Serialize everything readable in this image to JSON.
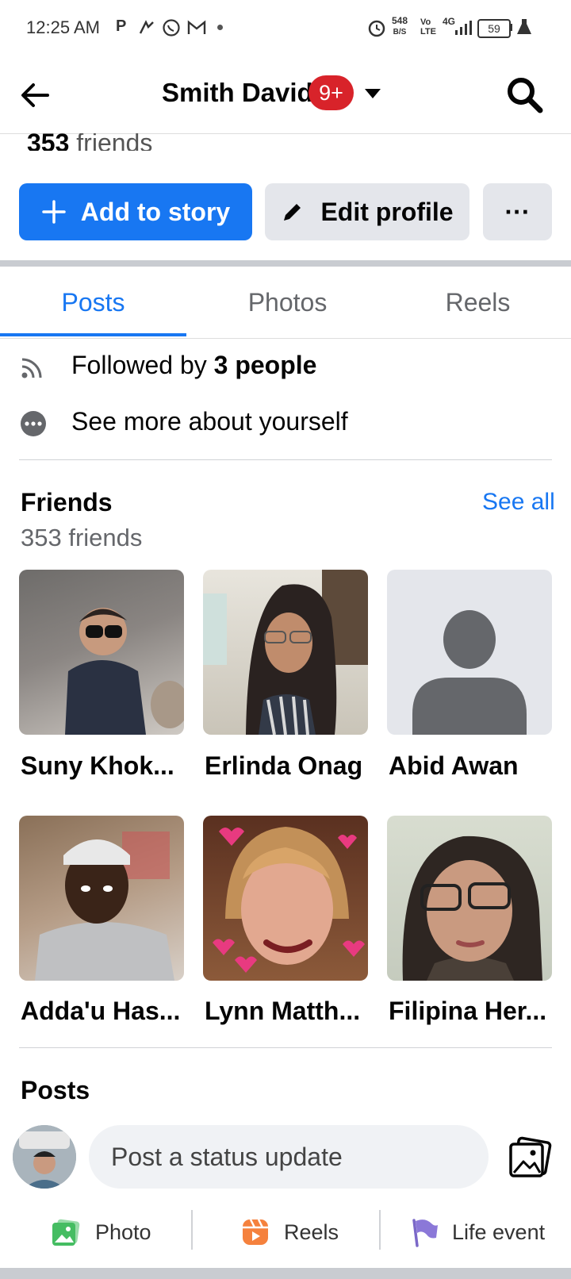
{
  "status_bar": {
    "time": "12:25 AM",
    "notif_icons": [
      "p-icon",
      "tracking-icon",
      "whatsapp-icon",
      "gmail-icon",
      "dot-icon"
    ],
    "net_speed_value": "548",
    "net_speed_unit": "B/S",
    "volte": "Vo LTE",
    "network": "4G",
    "battery": "59"
  },
  "header": {
    "name": "Smith David",
    "badge": "9+",
    "friends_peek_count": "353",
    "friends_peek_label": " friends"
  },
  "actions": {
    "add_story": "Add to story",
    "edit_profile": "Edit profile",
    "more": "···"
  },
  "tabs": [
    "Posts",
    "Photos",
    "Reels"
  ],
  "info": {
    "followed_prefix": "Followed by ",
    "followed_bold": "3 people",
    "see_more": "See more about yourself"
  },
  "friends": {
    "title": "Friends",
    "count": "353 friends",
    "see_all": "See all",
    "list": [
      {
        "name": "Suny Khok..."
      },
      {
        "name": "Erlinda Onag"
      },
      {
        "name": "Abid Awan"
      },
      {
        "name": "Adda'u Has..."
      },
      {
        "name": "Lynn Matth..."
      },
      {
        "name": "Filipina Her..."
      }
    ]
  },
  "posts": {
    "title": "Posts",
    "composer_placeholder": "Post a status update",
    "quick_actions": [
      "Photo",
      "Reels",
      "Life event"
    ]
  },
  "colors": {
    "accent": "#1877f2",
    "badge": "#d8232a",
    "button_gray": "#e4e6eb"
  }
}
